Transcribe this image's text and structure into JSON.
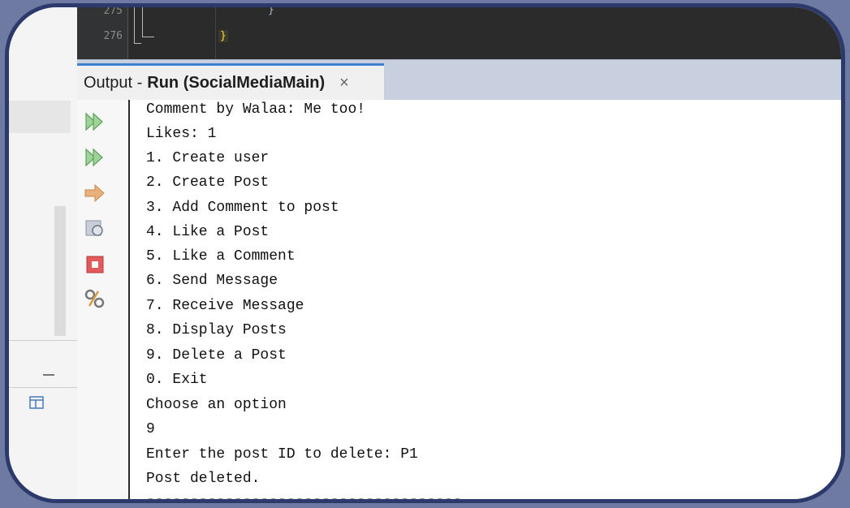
{
  "editor": {
    "line_numbers": [
      "275",
      "276"
    ],
    "line_275_text": "}",
    "line_276_text": "}"
  },
  "output_tab": {
    "prefix": "Output - ",
    "title": "Run (SocialMediaMain)",
    "close": "×"
  },
  "toolbar_icons": [
    "rerun-icon",
    "rerun-with-args-icon",
    "step-icon",
    "settings-icon",
    "stop-icon",
    "tools-icon"
  ],
  "console_lines": [
    "Comment by Walaa: Me too!",
    "Likes: 1",
    "1. Create user",
    "2. Create Post",
    "3. Add Comment to post",
    "4. Like a Post",
    "5. Like a Comment",
    "6. Send Message",
    "7. Receive Message",
    "8. Display Posts",
    "9. Delete a Post",
    "0. Exit",
    "Choose an option",
    "9",
    "Enter the post ID to delete: P1",
    "Post deleted.",
    "------------------------------------"
  ],
  "colors": {
    "background": "#6f7aa3",
    "frame_border": "#2c3a6b",
    "tab_accent": "#3d7fd1",
    "editor_bg": "#2b2b2b"
  }
}
